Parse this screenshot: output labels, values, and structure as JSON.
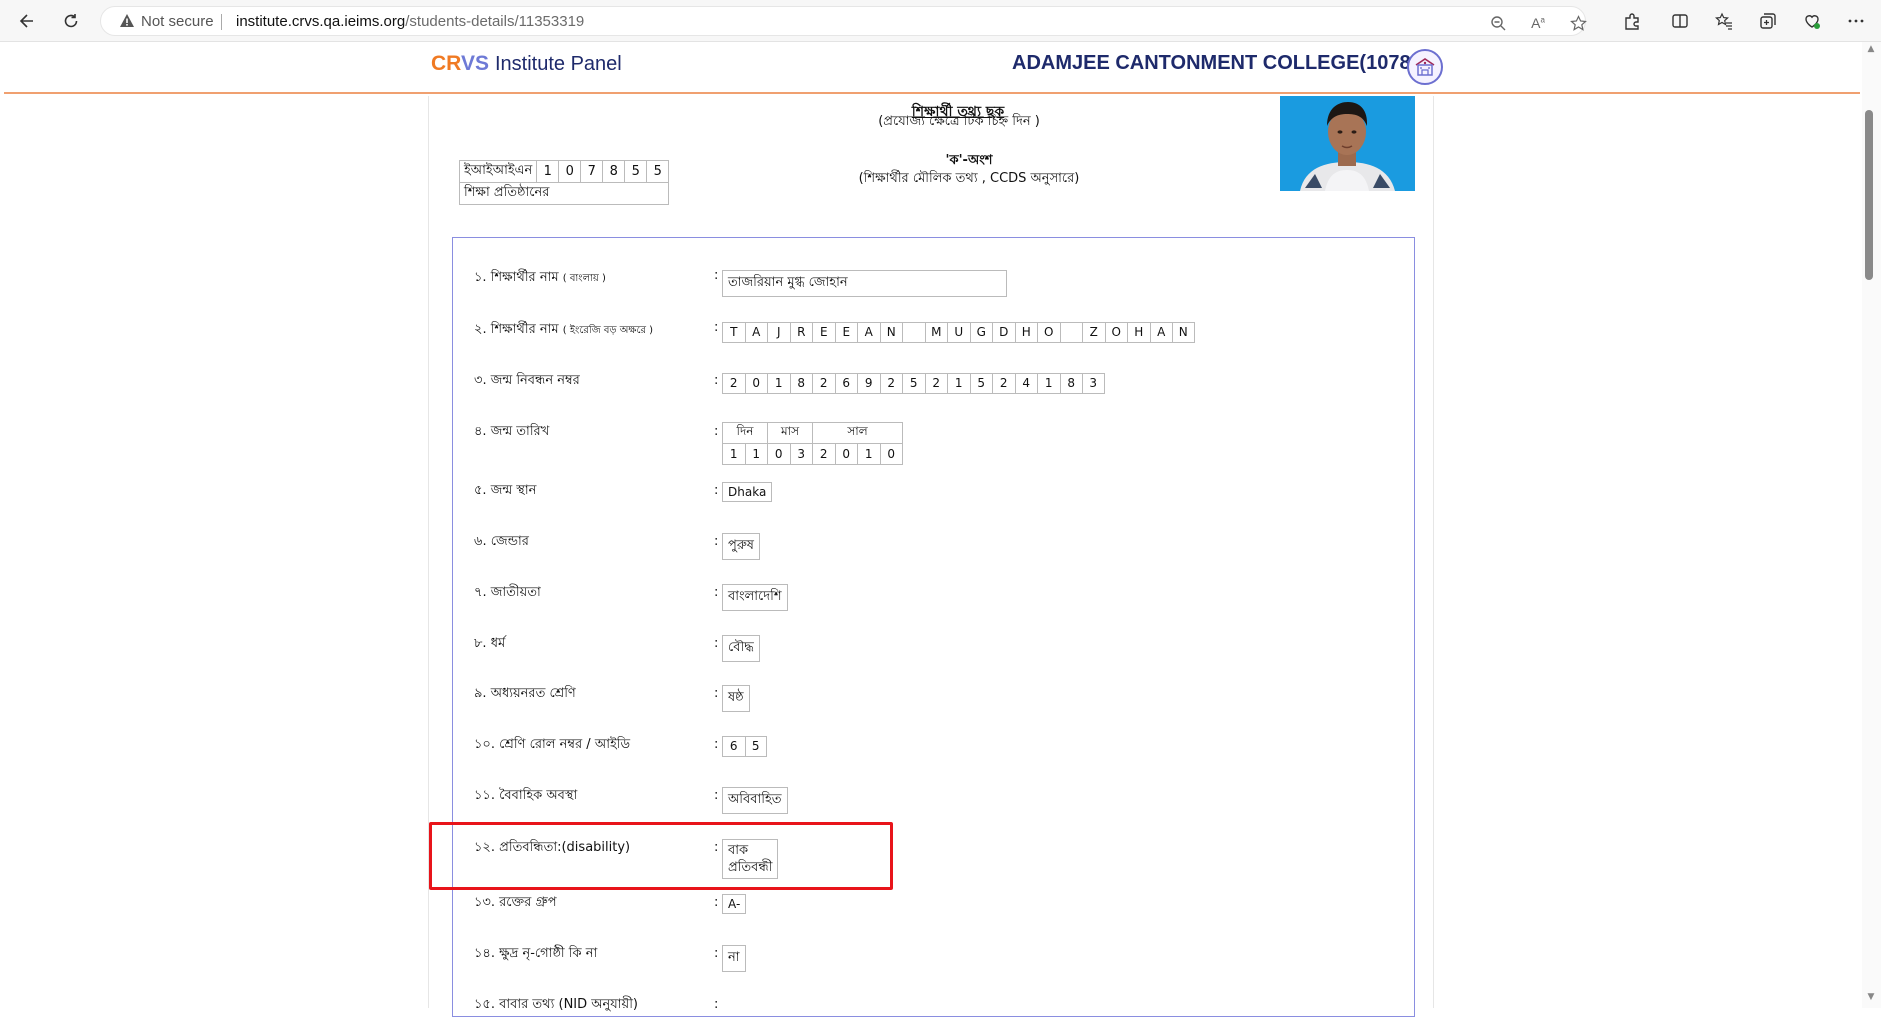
{
  "browser": {
    "not_secure": "Not secure",
    "url_host": "institute.crvs.qa.ieims.org",
    "url_path": "/students-details/11353319"
  },
  "header": {
    "brand_cr": "CR",
    "brand_vs": "VS",
    "brand_panel": "Institute Panel",
    "college": "ADAMJEE CANTONMENT COLLEGE(107855)"
  },
  "doc": {
    "title": "শিক্ষার্থী তথ্য ছক",
    "subtitle": "(প্রযোজ্য ক্ষেত্রে টিক চিহ্ন দিন )",
    "part_title": "'ক'-অংশ",
    "part_subtitle": "(শিক্ষার্থীর মৌলিক তথ্য , CCDS অনুসারে)",
    "eiin_label": "ইআইআইএন",
    "eiin_digits": [
      "1",
      "0",
      "7",
      "8",
      "5",
      "5"
    ],
    "institution_label": "শিক্ষা প্রতিষ্ঠানের"
  },
  "fields": {
    "name_bn_label": "১. শিক্ষার্থীর নাম",
    "name_bn_hint": "( বাংলায় )",
    "name_bn_value": "তাজরিয়ান মুগ্ধ জোহান",
    "name_en_label": "২. শিক্ষার্থীর নাম",
    "name_en_hint": "( ইংরেজি বড় অক্ষরে )",
    "name_en_chars": [
      "T",
      "A",
      "J",
      "R",
      "E",
      "E",
      "A",
      "N",
      " ",
      "M",
      "U",
      "G",
      "D",
      "H",
      "O",
      " ",
      "Z",
      "O",
      "H",
      "A",
      "N"
    ],
    "birth_reg_label": "৩. জন্ম নিবন্ধন নম্বর",
    "birth_reg_digits": [
      "2",
      "0",
      "1",
      "8",
      "2",
      "6",
      "9",
      "2",
      "5",
      "2",
      "1",
      "5",
      "2",
      "4",
      "1",
      "8",
      "3"
    ],
    "dob_label": "৪. জন্ম তারিখ",
    "dob_day_header": "দিন",
    "dob_month_header": "মাস",
    "dob_year_header": "সাল",
    "dob_digits": [
      "1",
      "1",
      "0",
      "3",
      "2",
      "0",
      "1",
      "0"
    ],
    "birthplace_label": "৫. জন্ম স্থান",
    "birthplace_value": "Dhaka",
    "gender_label": "৬. জেন্ডার",
    "gender_value": "পুরুষ",
    "nationality_label": "৭. জাতীয়তা",
    "nationality_value": "বাংলাদেশি",
    "religion_label": "৮. ধর্ম",
    "religion_value": "বৌদ্ধ",
    "class_label": "৯. অধ্যয়নরত শ্রেণি",
    "class_value": "ষষ্ঠ",
    "roll_label": "১০. শ্রেণি রোল নম্বর / আইডি",
    "roll_digits": [
      "6",
      "5"
    ],
    "marital_label": "১১. বৈবাহিক অবস্থা",
    "marital_value": "অবিবাহিত",
    "disability_label": "১২. প্রতিবন্ধিতা:(disability)",
    "disability_value_line1": "বাক",
    "disability_value_line2": "প্রতিবন্ধী",
    "blood_label": "১৩. রক্তের গ্রুপ",
    "blood_value": "A-",
    "ethnic_label": "১৪. ক্ষুদ্র নৃ-গোষ্ঠী কি না",
    "ethnic_value": "না",
    "father_label": "১৫. বাবার তথ্য (NID অনুযায়ী)"
  },
  "colors": {
    "brand_orange": "#f07a23",
    "brand_blue": "#1e2a6b",
    "highlight_red": "#e8141a"
  }
}
